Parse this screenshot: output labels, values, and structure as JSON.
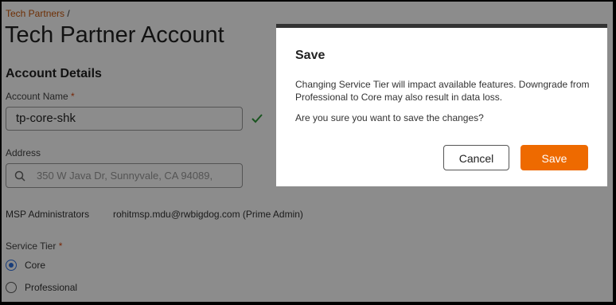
{
  "breadcrumb": {
    "link": "Tech Partners",
    "separator": "/"
  },
  "page": {
    "title": "Tech Partner Account"
  },
  "account_details": {
    "heading": "Account Details",
    "account_name": {
      "label": "Account Name",
      "required_mark": "*",
      "value": "tp-core-shk",
      "status_icon": "check-icon"
    },
    "address": {
      "label": "Address",
      "placeholder": "350 W Java Dr, Sunnyvale, CA 94089,",
      "icon": "search-icon"
    },
    "msp_administrators": {
      "label": "MSP Administrators",
      "value": "rohitmsp.mdu@rwbigdog.com (Prime Admin)"
    },
    "service_tier": {
      "label": "Service Tier",
      "required_mark": "*",
      "options": [
        {
          "label": "Core",
          "selected": true
        },
        {
          "label": "Professional",
          "selected": false
        }
      ]
    }
  },
  "modal": {
    "title": "Save",
    "message": "Changing Service Tier will impact available features. Downgrade from Professional to Core may also result in data loss.",
    "question": "Are you sure you want to save the changes?",
    "cancel_label": "Cancel",
    "save_label": "Save"
  },
  "colors": {
    "accent": "#ee6a00",
    "link": "#c8560a",
    "radio_selected": "#2f6fdc",
    "check": "#2e9a3a"
  }
}
